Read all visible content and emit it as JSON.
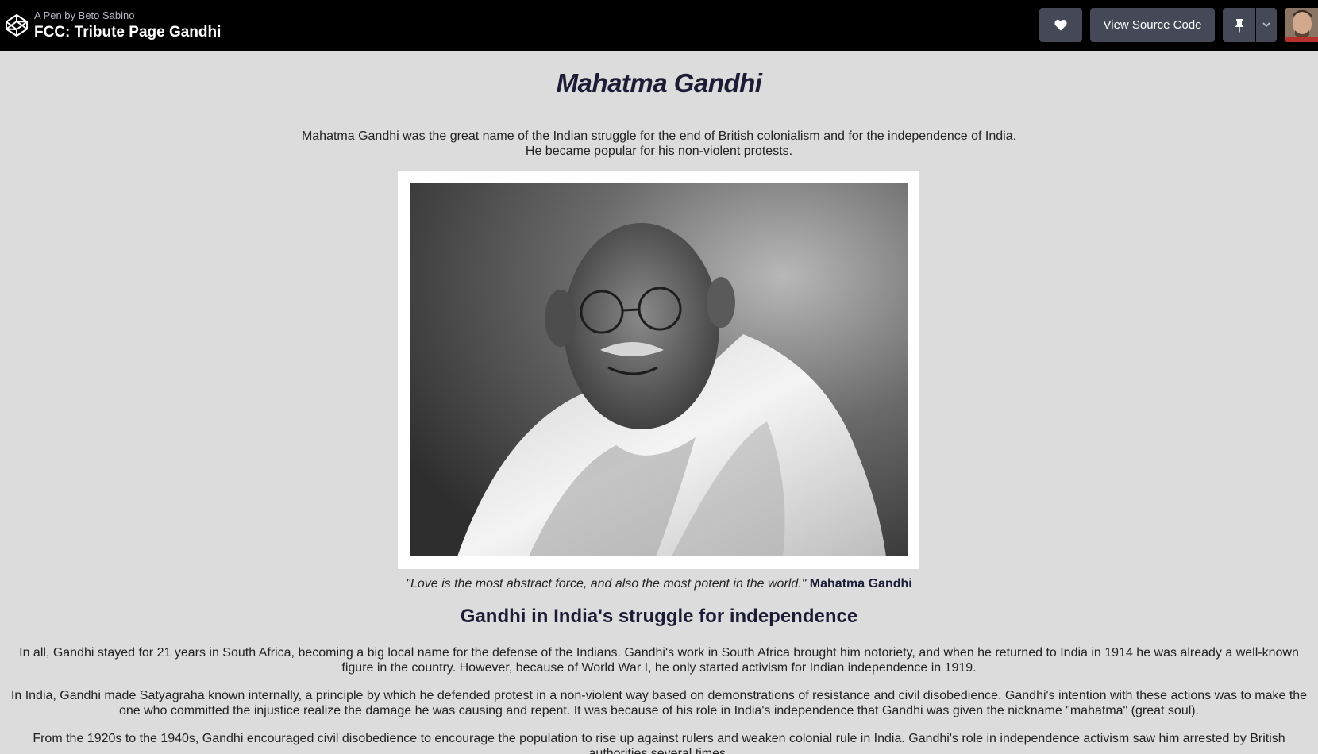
{
  "header": {
    "byline": "A Pen by Beto Sabino",
    "pen_title": "FCC: Tribute Page Gandhi",
    "view_source_label": "View Source Code"
  },
  "page": {
    "title": "Mahatma Gandhi",
    "intro_line1": "Mahatma Gandhi was the great name of the Indian struggle for the end of British colonialism and for the independence of India.",
    "intro_line2": "He became popular for his non-violent protests.",
    "quote_text": "\"Love is the most abstract force, and also the most potent in the world.\"",
    "quote_author": "Mahatma Gandhi",
    "section_heading": "Gandhi in India's struggle for independence",
    "paragraphs": [
      "In all, Gandhi stayed for 21 years in South Africa, becoming a big local name for the defense of the Indians. Gandhi's work in South Africa brought him notoriety, and when he returned to India in 1914 he was already a well-known figure in the country. However, because of World War I, he only started activism for Indian independence in 1919.",
      "In India, Gandhi made Satyagraha known internally, a principle by which he defended protest in a non-violent way based on demonstrations of resistance and civil disobedience. Gandhi's intention with these actions was to make the one who committed the injustice realize the damage he was causing and repent. It was because of his role in India's independence that Gandhi was given the nickname \"mahatma\" (great soul).",
      "From the 1920s to the 1940s, Gandhi encouraged civil disobedience to encourage the population to rise up against rulers and weaken colonial rule in India. Gandhi's role in independence activism saw him arrested by British authorities several times."
    ]
  },
  "icons": {
    "logo": "codepen-logo-icon",
    "heart": "heart-icon",
    "pin": "pin-icon",
    "caret": "chevron-down-icon"
  },
  "colors": {
    "header_bg": "#000000",
    "button_bg": "#444857",
    "page_bg": "#dcdcdc",
    "heading": "#1c1c36"
  }
}
